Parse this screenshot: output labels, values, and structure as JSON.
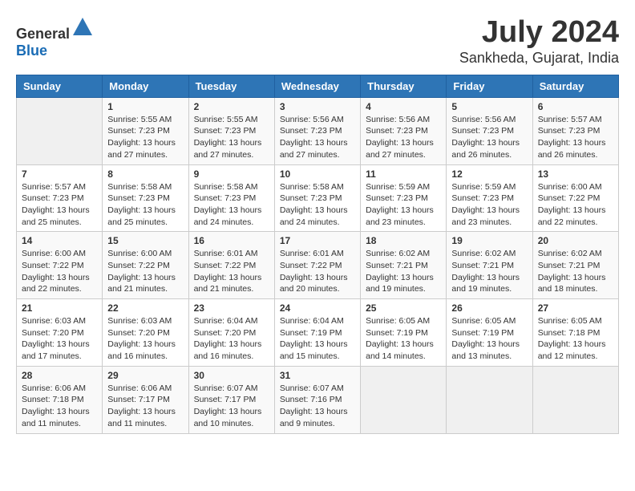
{
  "header": {
    "logo": {
      "general": "General",
      "blue": "Blue"
    },
    "title": "July 2024",
    "location": "Sankheda, Gujarat, India"
  },
  "calendar": {
    "headers": [
      "Sunday",
      "Monday",
      "Tuesday",
      "Wednesday",
      "Thursday",
      "Friday",
      "Saturday"
    ],
    "weeks": [
      [
        {
          "day": null,
          "info": null
        },
        {
          "day": "1",
          "sunrise": "5:55 AM",
          "sunset": "7:23 PM",
          "daylight": "13 hours and 27 minutes."
        },
        {
          "day": "2",
          "sunrise": "5:55 AM",
          "sunset": "7:23 PM",
          "daylight": "13 hours and 27 minutes."
        },
        {
          "day": "3",
          "sunrise": "5:56 AM",
          "sunset": "7:23 PM",
          "daylight": "13 hours and 27 minutes."
        },
        {
          "day": "4",
          "sunrise": "5:56 AM",
          "sunset": "7:23 PM",
          "daylight": "13 hours and 27 minutes."
        },
        {
          "day": "5",
          "sunrise": "5:56 AM",
          "sunset": "7:23 PM",
          "daylight": "13 hours and 26 minutes."
        },
        {
          "day": "6",
          "sunrise": "5:57 AM",
          "sunset": "7:23 PM",
          "daylight": "13 hours and 26 minutes."
        }
      ],
      [
        {
          "day": "7",
          "sunrise": "5:57 AM",
          "sunset": "7:23 PM",
          "daylight": "13 hours and 25 minutes."
        },
        {
          "day": "8",
          "sunrise": "5:58 AM",
          "sunset": "7:23 PM",
          "daylight": "13 hours and 25 minutes."
        },
        {
          "day": "9",
          "sunrise": "5:58 AM",
          "sunset": "7:23 PM",
          "daylight": "13 hours and 24 minutes."
        },
        {
          "day": "10",
          "sunrise": "5:58 AM",
          "sunset": "7:23 PM",
          "daylight": "13 hours and 24 minutes."
        },
        {
          "day": "11",
          "sunrise": "5:59 AM",
          "sunset": "7:23 PM",
          "daylight": "13 hours and 23 minutes."
        },
        {
          "day": "12",
          "sunrise": "5:59 AM",
          "sunset": "7:23 PM",
          "daylight": "13 hours and 23 minutes."
        },
        {
          "day": "13",
          "sunrise": "6:00 AM",
          "sunset": "7:22 PM",
          "daylight": "13 hours and 22 minutes."
        }
      ],
      [
        {
          "day": "14",
          "sunrise": "6:00 AM",
          "sunset": "7:22 PM",
          "daylight": "13 hours and 22 minutes."
        },
        {
          "day": "15",
          "sunrise": "6:00 AM",
          "sunset": "7:22 PM",
          "daylight": "13 hours and 21 minutes."
        },
        {
          "day": "16",
          "sunrise": "6:01 AM",
          "sunset": "7:22 PM",
          "daylight": "13 hours and 21 minutes."
        },
        {
          "day": "17",
          "sunrise": "6:01 AM",
          "sunset": "7:22 PM",
          "daylight": "13 hours and 20 minutes."
        },
        {
          "day": "18",
          "sunrise": "6:02 AM",
          "sunset": "7:21 PM",
          "daylight": "13 hours and 19 minutes."
        },
        {
          "day": "19",
          "sunrise": "6:02 AM",
          "sunset": "7:21 PM",
          "daylight": "13 hours and 19 minutes."
        },
        {
          "day": "20",
          "sunrise": "6:02 AM",
          "sunset": "7:21 PM",
          "daylight": "13 hours and 18 minutes."
        }
      ],
      [
        {
          "day": "21",
          "sunrise": "6:03 AM",
          "sunset": "7:20 PM",
          "daylight": "13 hours and 17 minutes."
        },
        {
          "day": "22",
          "sunrise": "6:03 AM",
          "sunset": "7:20 PM",
          "daylight": "13 hours and 16 minutes."
        },
        {
          "day": "23",
          "sunrise": "6:04 AM",
          "sunset": "7:20 PM",
          "daylight": "13 hours and 16 minutes."
        },
        {
          "day": "24",
          "sunrise": "6:04 AM",
          "sunset": "7:19 PM",
          "daylight": "13 hours and 15 minutes."
        },
        {
          "day": "25",
          "sunrise": "6:05 AM",
          "sunset": "7:19 PM",
          "daylight": "13 hours and 14 minutes."
        },
        {
          "day": "26",
          "sunrise": "6:05 AM",
          "sunset": "7:19 PM",
          "daylight": "13 hours and 13 minutes."
        },
        {
          "day": "27",
          "sunrise": "6:05 AM",
          "sunset": "7:18 PM",
          "daylight": "13 hours and 12 minutes."
        }
      ],
      [
        {
          "day": "28",
          "sunrise": "6:06 AM",
          "sunset": "7:18 PM",
          "daylight": "13 hours and 11 minutes."
        },
        {
          "day": "29",
          "sunrise": "6:06 AM",
          "sunset": "7:17 PM",
          "daylight": "13 hours and 11 minutes."
        },
        {
          "day": "30",
          "sunrise": "6:07 AM",
          "sunset": "7:17 PM",
          "daylight": "13 hours and 10 minutes."
        },
        {
          "day": "31",
          "sunrise": "6:07 AM",
          "sunset": "7:16 PM",
          "daylight": "13 hours and 9 minutes."
        },
        {
          "day": null,
          "info": null
        },
        {
          "day": null,
          "info": null
        },
        {
          "day": null,
          "info": null
        }
      ]
    ]
  }
}
